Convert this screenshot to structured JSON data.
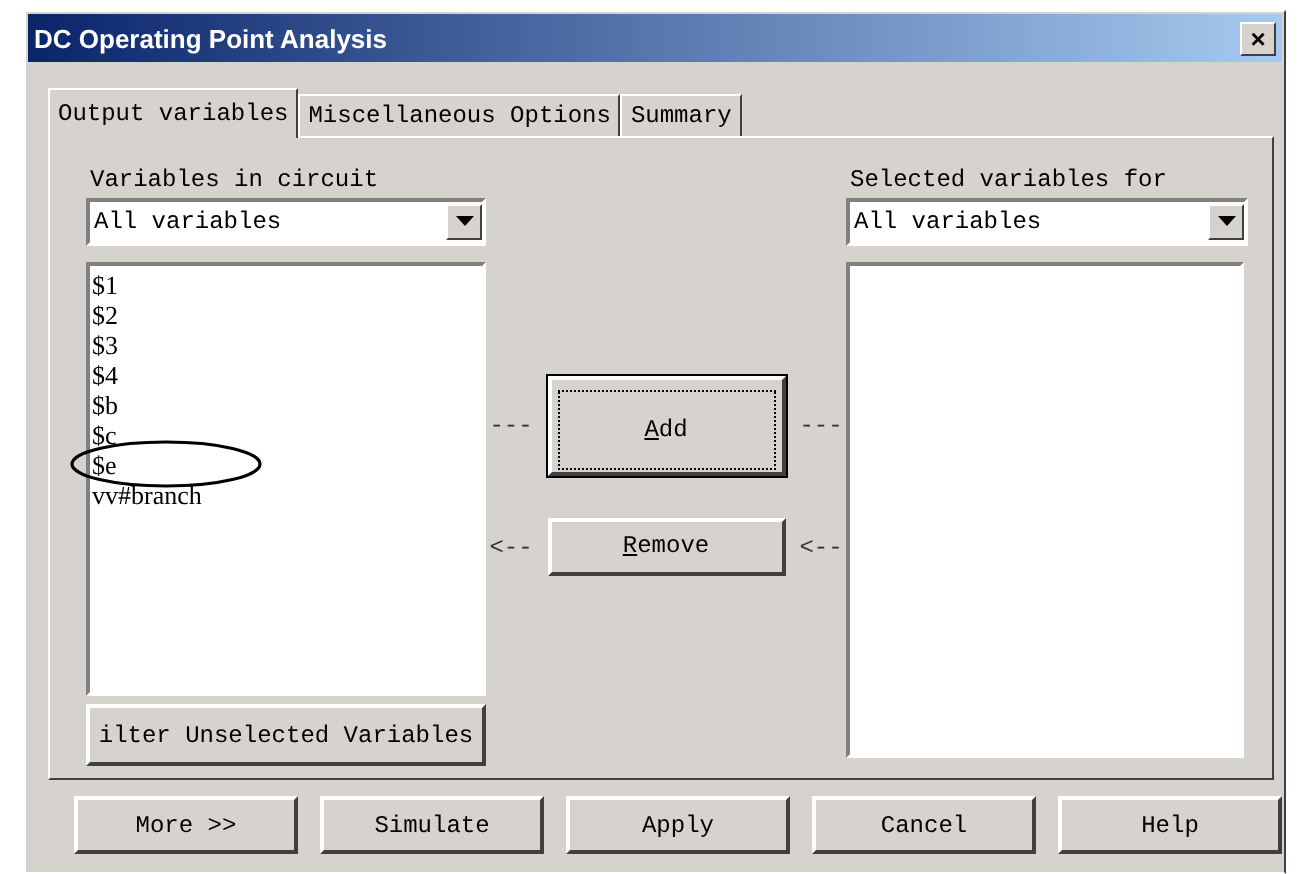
{
  "window": {
    "title": "DC Operating Point Analysis",
    "close": "×"
  },
  "tabs": [
    {
      "label": "Output variables",
      "selected": true
    },
    {
      "label": "Miscellaneous Options",
      "selected": false
    },
    {
      "label": "Summary",
      "selected": false
    }
  ],
  "left": {
    "label": "Variables in circuit",
    "dropdown": "All variables",
    "items": [
      {
        "label": "$1",
        "circled": false
      },
      {
        "label": "$2",
        "circled": false
      },
      {
        "label": "$3",
        "circled": false
      },
      {
        "label": "$4",
        "circled": false
      },
      {
        "label": "$b",
        "circled": false
      },
      {
        "label": "$c",
        "circled": false
      },
      {
        "label": "$e",
        "circled": true
      },
      {
        "label": "vv#branch",
        "circled": false
      }
    ],
    "filter_button": "ilter Unselected Variables"
  },
  "middle": {
    "add": {
      "label": "Add",
      "focused": true,
      "left_marker": "---",
      "right_marker": "---"
    },
    "remove": {
      "label": "Remove",
      "focused": false,
      "left_marker": "<--",
      "right_marker": "<--"
    }
  },
  "right": {
    "label": "Selected variables for",
    "dropdown": "All variables"
  },
  "buttons": [
    "More >>",
    "Simulate",
    "Apply",
    "Cancel",
    "Help"
  ]
}
